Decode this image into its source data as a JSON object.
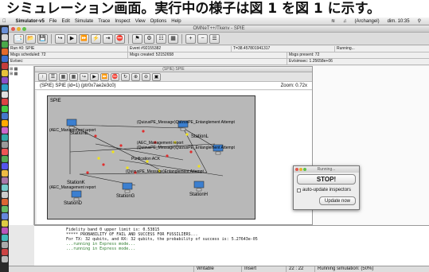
{
  "caption": "シミュレーション画面。実行中の様子は図 1 を図 1 に示す。",
  "menubar": {
    "app": "Simulator-v5",
    "items": [
      "File",
      "Edit",
      "Simulate",
      "Trace",
      "Inspect",
      "View",
      "Options",
      "Help"
    ],
    "user": "(Archangel)",
    "clock": "dim. 10:35"
  },
  "window": {
    "title": "OMNeT++/Tkenv - SPIE",
    "path_hint": "Simulator - Simulator-v5 - Simulation - OMNeT++ IDE - /Users/.../Projects/Simulator"
  },
  "status": {
    "run": "Run #0: SPIE",
    "event": "Event #92155382",
    "time": "T=38.457801941317",
    "running": "Running...",
    "msgs_scheduled": "Msgs scheduled: 72",
    "msgs_created": "Msgs created: 52152658",
    "msgs_present": "Msgs present: 72",
    "ev_sec_label": "Ev/sec:",
    "ev_sec_value": "Ev/simsec: 1.25658e+06"
  },
  "inner": {
    "title": "(SPIE) SPIE",
    "module": "(SPIE) SPIE (id=1) (ptr0x7ae2e3c0)",
    "zoom": "Zoom: 0.72x",
    "net_label": "SPIE"
  },
  "stations": [
    "StationL",
    "StationD",
    "StationG",
    "StationH",
    "StationK",
    "StationE"
  ],
  "messages": [
    "(AEC_Management report",
    "(QuizusPE_Message)QuizusPE_Entanglement Attempt",
    "(AEC_Management report",
    "(QuizusPE_Message)QuizusPE_Entanglement Attempt",
    "Purification ACK",
    "(QuizusPE_Message)Entanglement Attempt",
    "(AEC_Management report"
  ],
  "running_dialog": {
    "title": "Running...",
    "stop": "STOP!",
    "auto_update": "auto-update inspectors",
    "update_now": "Update now"
  },
  "console_lines": [
    "Fidelity band 0 upper limit is: 0.53815",
    "",
    "***** PROBABILITY OF FAIL AND SUCCESS FOR FUSSILIERS...",
    "",
    "For TX: 32 qubits, and RX: 32 qubits, the probability of success is: 5.27643e-05",
    "...running in Express mode...",
    "...running in Express mode..."
  ],
  "statusbar": {
    "writable": "Writable",
    "insert": "Insert",
    "pos": "22 : 22",
    "progress": "Running simulation: (50%)"
  },
  "colors": {
    "accent": "#d43c3c",
    "highlight": "#f0e21a"
  }
}
